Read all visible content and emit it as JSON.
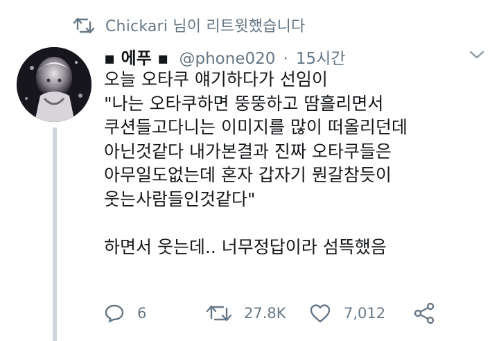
{
  "retweet": {
    "text": "Chickari 님이 리트윗했습니다",
    "icon": "retweet-icon"
  },
  "tweet": {
    "name": "▪︎ 에푸 ▪︎",
    "handle": "@phone020",
    "separator": "·",
    "time": "15시간",
    "body": "오늘 오타쿠 얘기하다가 선임이\n\"나는 오타쿠하면 뚱뚱하고 땀흘리면서\n쿠션들고다니는 이미지를 많이 떠올리던데\n아닌것같다 내가본결과 진짜 오타쿠들은\n아무일도없는데 혼자 갑자기 뭔갈참듯이\n웃는사람들인것같다\"\n\n하면서 웃는데.. 너무정답이라 섬뜩했음"
  },
  "actions": {
    "reply_count": "6",
    "retweet_count": "27.8K",
    "like_count": "7,012"
  },
  "colors": {
    "secondary_text": "#657786",
    "primary_text": "#14171a",
    "thread_line": "#ccd6dd"
  }
}
